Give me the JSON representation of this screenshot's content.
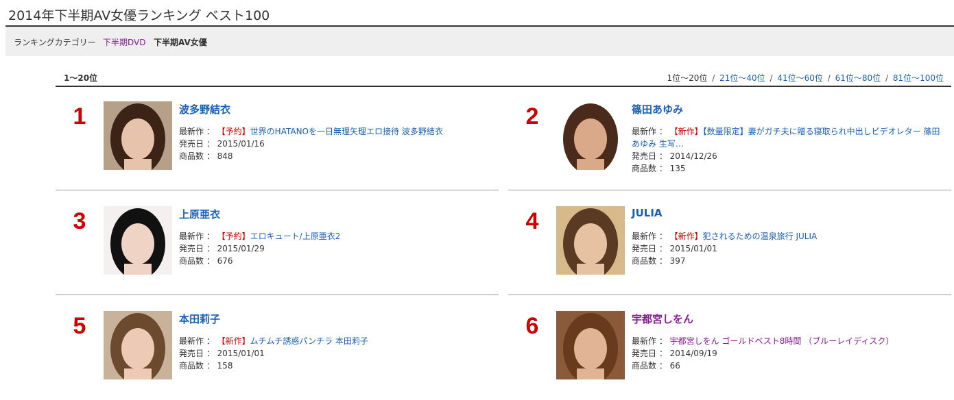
{
  "page": {
    "title": "2014年下半期AV女優ランキング ベスト100"
  },
  "category": {
    "label": "ランキングカテゴリー",
    "link": "下半期DVD",
    "current": "下半期AV女優"
  },
  "range": {
    "current": "1～20位"
  },
  "pager": {
    "current": "1位～20位",
    "links": [
      "21位～40位",
      "41位～60位",
      "61位～80位",
      "81位～100位"
    ],
    "separator": "/"
  },
  "labels": {
    "latest": "最新作 ：",
    "release": "発売日 ：",
    "count": "商品数 ："
  },
  "actresses": [
    {
      "rank": "1",
      "name": "波多野結衣",
      "tag": "【予約】",
      "work": "世界のHATANOを一日無理矢理エロ接待 波多野結衣",
      "release_date": "2015/01/16",
      "count": "848",
      "photo": {
        "bg": "#b7a08a",
        "hair": "#3b2416",
        "skin": "#e8c3ac"
      }
    },
    {
      "rank": "2",
      "name": "篠田あゆみ",
      "tag": "【新作】",
      "work": "【数量限定】妻がガチ夫に贈る寝取られ中出しビデオレター 篠田あゆみ 生写…",
      "release_date": "2014/12/26",
      "count": "135",
      "photo": {
        "bg": "#ffffff",
        "hair": "#4a2a1a",
        "skin": "#d9a98a"
      }
    },
    {
      "rank": "3",
      "name": "上原亜衣",
      "tag": "【予約】",
      "work": "エロキュート/上原亜衣2",
      "release_date": "2015/01/29",
      "count": "676",
      "photo": {
        "bg": "#f3f0ef",
        "hair": "#111111",
        "skin": "#efd3c4"
      }
    },
    {
      "rank": "4",
      "name": "JULIA",
      "tag": "【新作】",
      "work": "犯されるための温泉旅行 JULIA",
      "release_date": "2015/01/01",
      "count": "397",
      "photo": {
        "bg": "#d8b98a",
        "hair": "#5a3a22",
        "skin": "#e7c2a2"
      }
    },
    {
      "rank": "5",
      "name": "本田莉子",
      "tag": "【新作】",
      "work": "ムチムチ誘惑パンチラ 本田莉子",
      "release_date": "2015/01/01",
      "count": "158",
      "photo": {
        "bg": "#c9b29c",
        "hair": "#6b4a2e",
        "skin": "#eccab5"
      }
    },
    {
      "rank": "6",
      "name": "宇都宮しをん",
      "tag": "",
      "work": "宇都宮しをん ゴールドベスト8時間 （ブルーレイディスク）",
      "release_date": "2014/09/19",
      "count": "66",
      "photo": {
        "bg": "#8a5a3a",
        "hair": "#6a3a1e",
        "skin": "#e0b495"
      }
    }
  ],
  "colors": {
    "rank": "#cc0000",
    "link": "#1a5fb4",
    "visited": "#8b1a99",
    "tag": "#cc0000"
  }
}
